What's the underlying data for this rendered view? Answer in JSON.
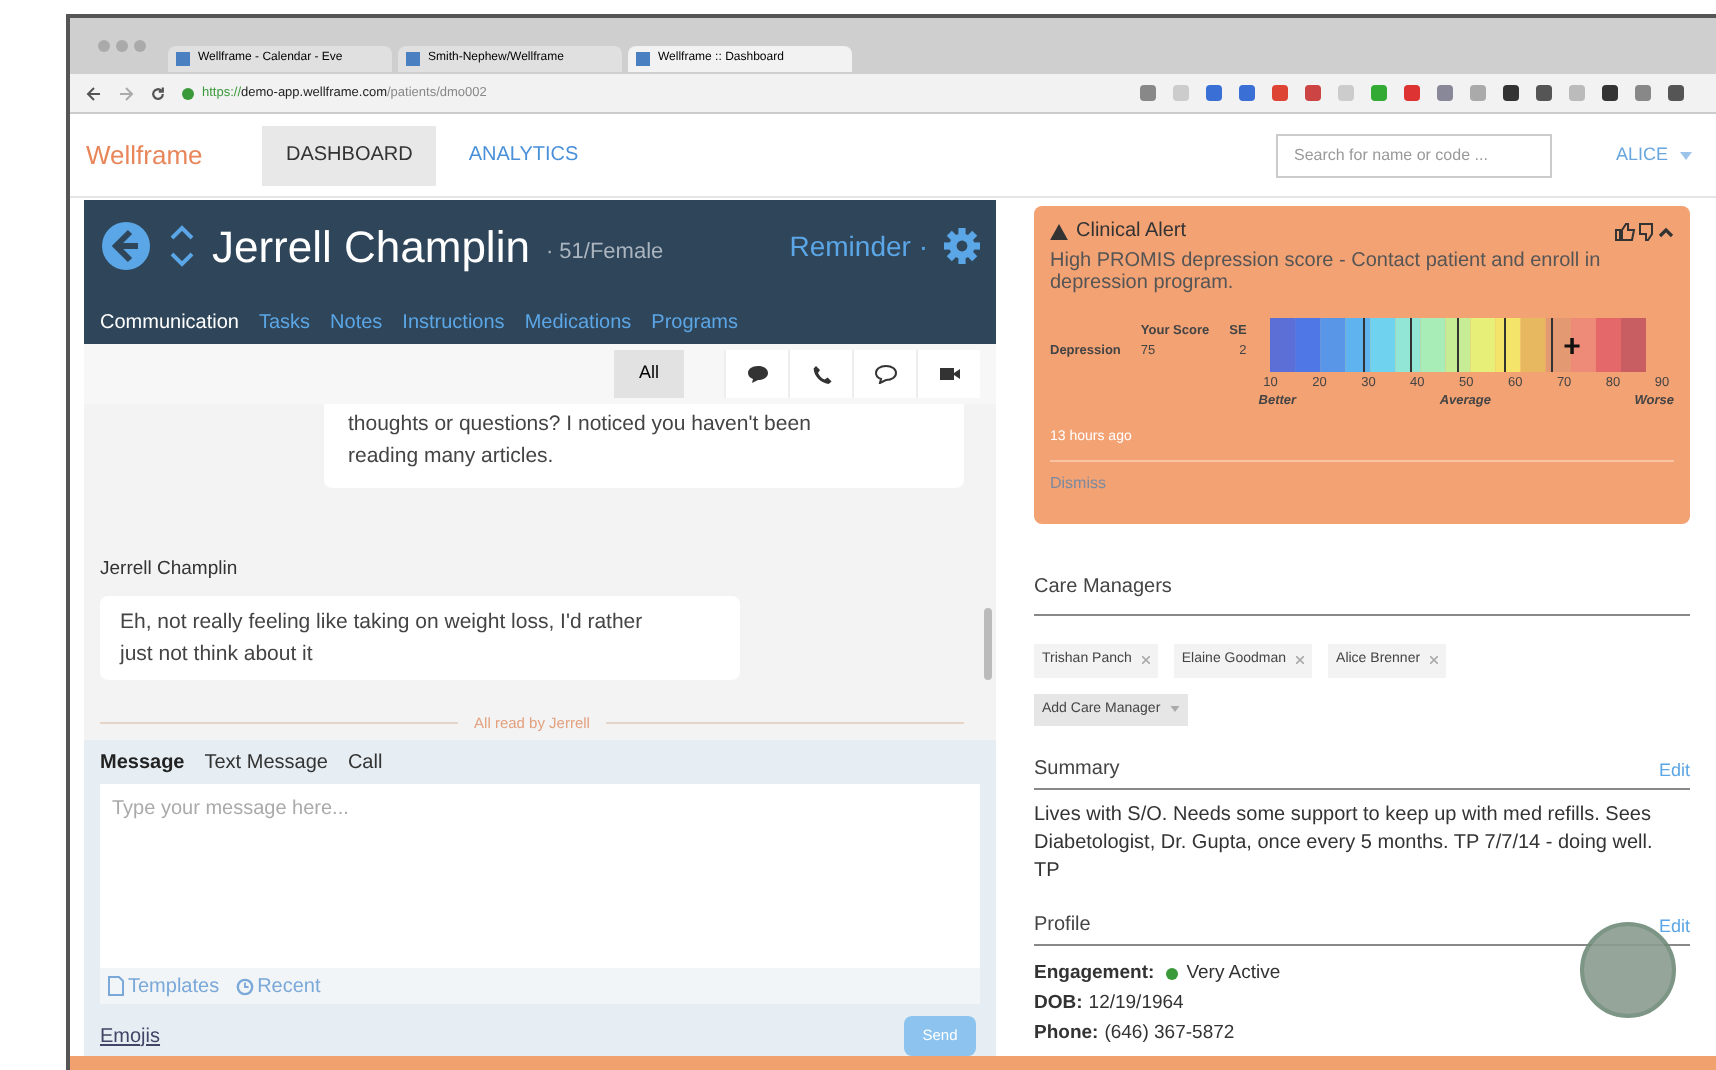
{
  "browser": {
    "tabs": [
      {
        "label": "Wellframe - Calendar - Eve",
        "selected": false
      },
      {
        "label": "Smith-Nephew/Wellframe",
        "selected": false
      },
      {
        "label": "Wellframe :: Dashboard",
        "selected": true
      }
    ],
    "url_secure": "https://",
    "url_host": "demo-app.wellframe.com",
    "url_path": "/patients/dmo002"
  },
  "nav": {
    "logo": "Wellframe",
    "items": [
      {
        "label": "DASHBOARD",
        "selected": true
      },
      {
        "label": "ANALYTICS",
        "selected": false
      }
    ],
    "search": {
      "placeholder": "Search for name or code ..."
    },
    "user": "ALICE"
  },
  "patient": {
    "name": "Jerrell Champlin",
    "info": "· 51/Female",
    "reminder": "Reminder ·"
  },
  "patient_tabs": [
    {
      "label": "Communication",
      "selected": true
    },
    {
      "label": "Tasks",
      "selected": false
    },
    {
      "label": "Notes",
      "selected": false
    },
    {
      "label": "Instructions",
      "selected": false
    },
    {
      "label": "Medications",
      "selected": false
    },
    {
      "label": "Programs",
      "selected": false
    }
  ],
  "filters": {
    "all": {
      "label": "All",
      "selected": true
    }
  },
  "messages": [
    {
      "kind": "outgoing",
      "text": "thoughts or questions? I noticed you haven't been reading many articles."
    },
    {
      "kind": "incoming",
      "sender": "Jerrell Champlin",
      "text": "Eh, not really feeling like taking on weight loss, I'd rather just not think about it"
    }
  ],
  "read_status": "All read by Jerrell",
  "composer": {
    "modes": [
      {
        "label": "Message",
        "selected": true
      },
      {
        "label": "Text Message",
        "selected": false
      },
      {
        "label": "Call",
        "selected": false
      }
    ],
    "placeholder": "Type your message here...",
    "templates": "Templates",
    "recent": "Recent",
    "emojis": "Emojis",
    "send": "Send"
  },
  "alert": {
    "title": "Clinical Alert",
    "text": "High PROMIS depression score - Contact patient and enroll in depression program.",
    "score_header": "Your Score",
    "se_header": "SE",
    "measure": "Depression",
    "score": "75",
    "se": "2",
    "ticks": [
      "10",
      "20",
      "30",
      "40",
      "50",
      "60",
      "70",
      "80",
      "90"
    ],
    "scale_labels": [
      "Better",
      "Average",
      "Worse"
    ],
    "time": "13 hours ago",
    "dismiss": "Dismiss"
  },
  "care_managers": {
    "title": "Care Managers",
    "people": [
      "Trishan Panch",
      "Elaine Goodman",
      "Alice Brenner"
    ],
    "add": "Add Care Manager"
  },
  "summary": {
    "title": "Summary",
    "edit": "Edit",
    "text": "Lives with S/O. Needs some support to keep up with med refills. Sees Diabetologist, Dr. Gupta, once every 5 months. TP 7/7/14 - doing well. TP"
  },
  "profile": {
    "title": "Profile",
    "edit": "Edit",
    "engagement_label": "Engagement:",
    "engagement": "Very Active",
    "color": "#3a9a3a",
    "rows": [
      {
        "label": "DOB:",
        "value": "12/19/1964"
      },
      {
        "label": "Phone:",
        "value": "(646) 367-5872"
      }
    ]
  }
}
